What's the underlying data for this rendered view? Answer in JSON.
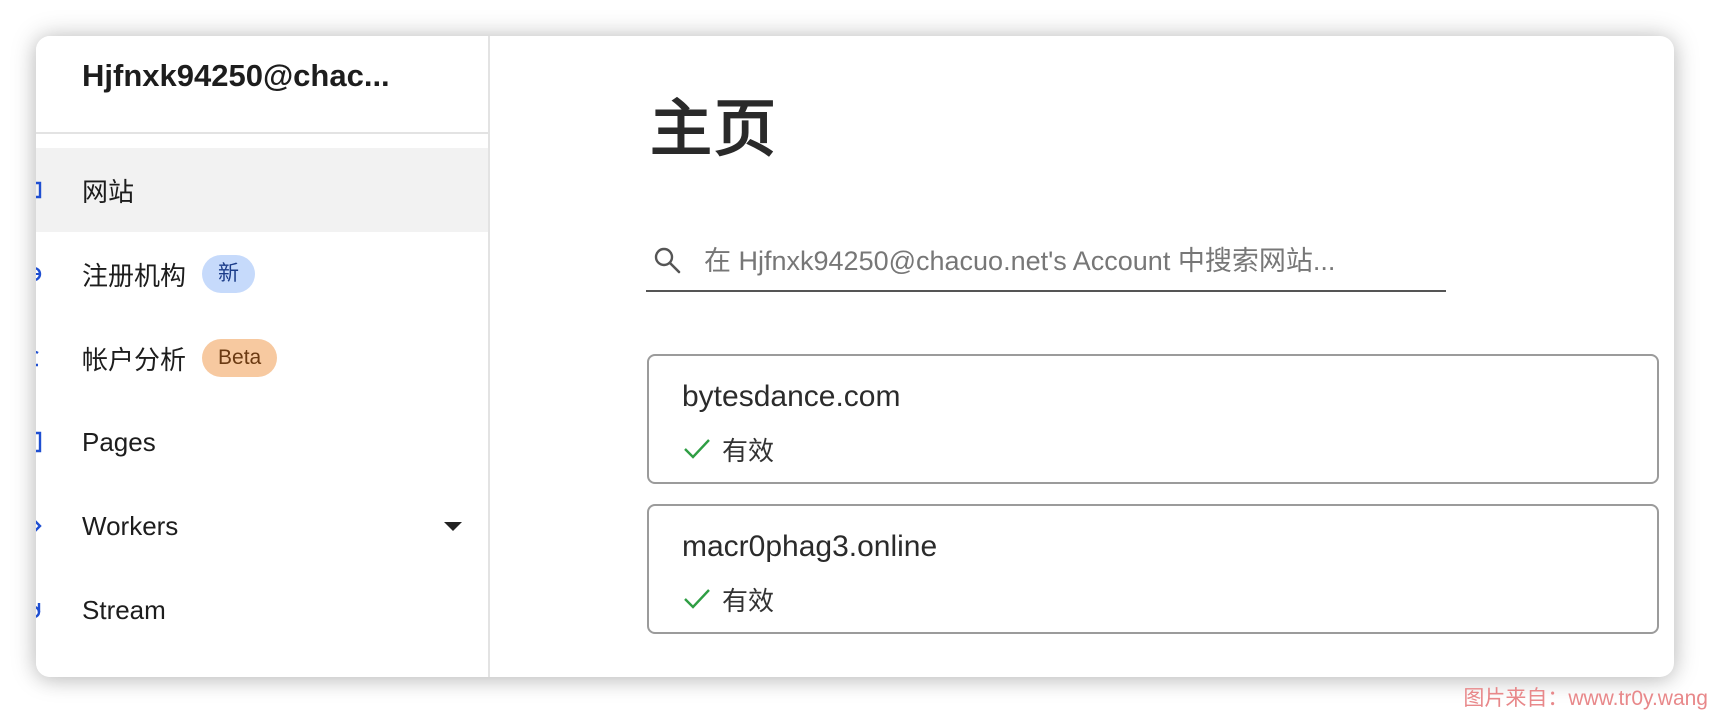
{
  "sidebar": {
    "account_name": "Hjfnxk94250@chac...",
    "items": [
      {
        "label": "网站",
        "icon": "globe-icon",
        "active": true
      },
      {
        "label": "注册机构",
        "icon": "registrar-icon",
        "badge": "新"
      },
      {
        "label": "帐户分析",
        "icon": "analytics-icon",
        "badge": "Beta"
      },
      {
        "label": "Pages",
        "icon": "pages-icon"
      },
      {
        "label": "Workers",
        "icon": "workers-icon",
        "expandable": true
      },
      {
        "label": "Stream",
        "icon": "stream-icon"
      }
    ]
  },
  "main": {
    "title": "主页",
    "search": {
      "placeholder": "在 Hjfnxk94250@chacuo.net's Account 中搜索网站...",
      "icon": "search-icon"
    },
    "sites": [
      {
        "name": "bytesdance.com",
        "status": "有效",
        "status_icon": "check-icon"
      },
      {
        "name": "macr0phag3.online",
        "status": "有效",
        "status_icon": "check-icon"
      }
    ]
  },
  "watermark": "图片来自：www.tr0y.wang",
  "colors": {
    "nav_icon": "#1f4fd1",
    "badge_new_bg": "#c6dafb",
    "badge_beta_bg": "#f7c9a0",
    "status_ok": "#2f9e44",
    "active_bg": "#f2f2f2"
  }
}
